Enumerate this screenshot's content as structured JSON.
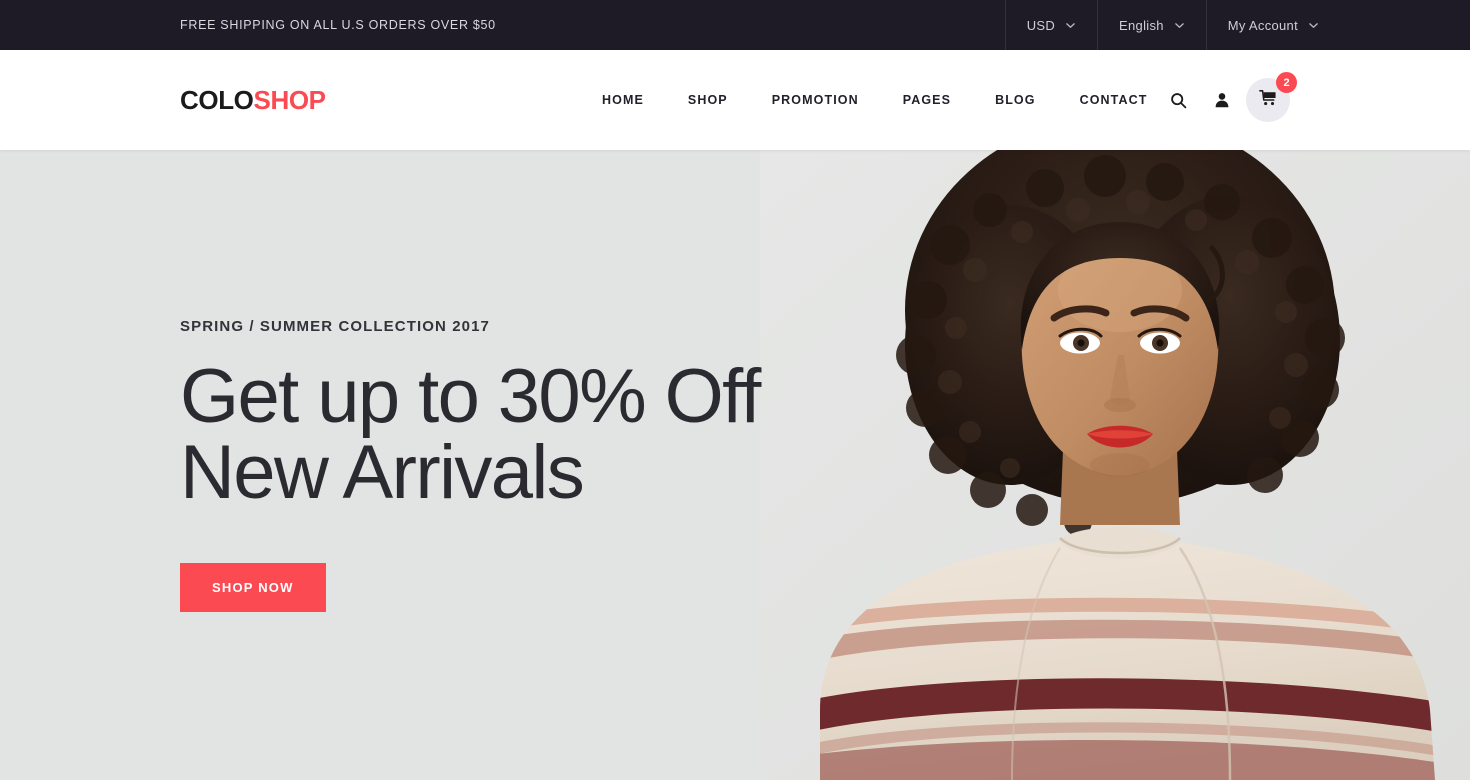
{
  "topbar": {
    "shipping_notice": "FREE SHIPPING ON ALL U.S ORDERS OVER $50",
    "currency": {
      "label": "USD",
      "icon": "chevron-down-icon"
    },
    "language": {
      "label": "English",
      "icon": "chevron-down-icon"
    },
    "account": {
      "label": "My Account",
      "icon": "chevron-down-icon"
    }
  },
  "header": {
    "logo": {
      "part1": "COLO",
      "part2": "SHOP"
    },
    "nav": [
      {
        "label": "HOME"
      },
      {
        "label": "SHOP"
      },
      {
        "label": "PROMOTION"
      },
      {
        "label": "PAGES"
      },
      {
        "label": "BLOG"
      },
      {
        "label": "CONTACT"
      }
    ],
    "icons": {
      "search": "search-icon",
      "account": "user-icon",
      "cart": "shopping-cart-icon"
    },
    "cart_count": "2"
  },
  "hero": {
    "eyebrow": "SPRING / SUMMER COLLECTION 2017",
    "headline": "Get up to 30% Off\nNew Arrivals",
    "cta_label": "SHOP NOW",
    "image_alt": "Model with curly hair wearing a cream striped sweater"
  },
  "colors": {
    "accent": "#fb4a52",
    "topbar_bg": "#1e1b26",
    "hero_bg": "#e2e3e3",
    "header_bg": "#ffffff",
    "text_dark": "#1b1b1b"
  }
}
